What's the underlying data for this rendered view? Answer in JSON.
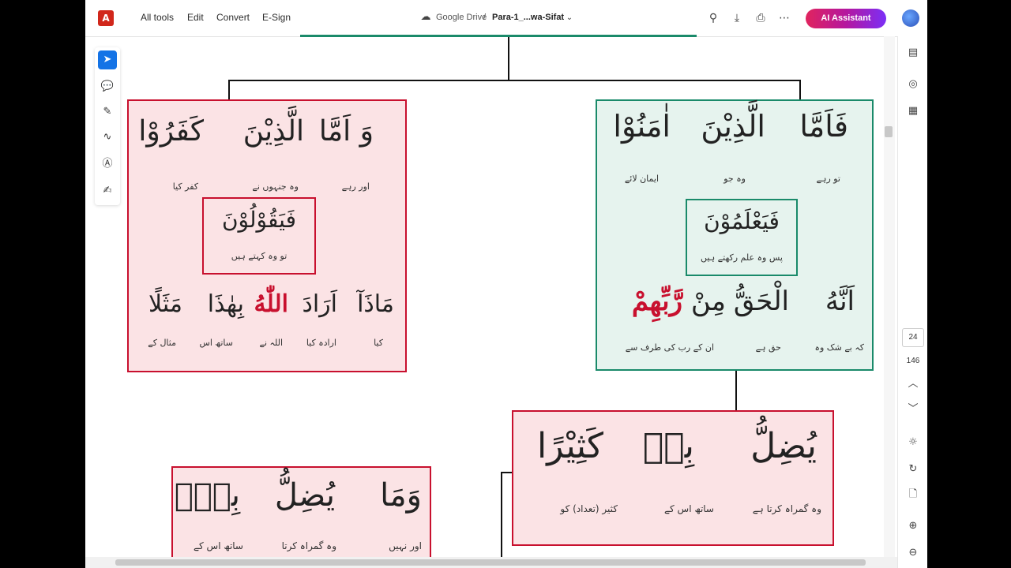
{
  "toolbar": {
    "logo_glyph": "A",
    "menu": [
      "All tools",
      "Edit",
      "Convert",
      "E-Sign"
    ],
    "drive_label": "Google Drive",
    "separator": "/",
    "file_name": "Para-1_...wa-Sifat",
    "ai_button": "AI Assistant"
  },
  "sidebar": {
    "page_current": "24",
    "page_total": "146"
  },
  "diagram": {
    "top_right": {
      "words": [
        "فَاَمَّا",
        "الَّذِيْنَ",
        "اٰمَنُوْا"
      ],
      "meanings": [
        "تو رہے",
        "وہ جو",
        "ایمان لائے"
      ],
      "inner_word": "فَيَعْلَمُوْنَ",
      "inner_meaning": "پس وہ علم رکھتے ہیں",
      "bottom_words": [
        "اَنَّهُ",
        "الْحَقُّ",
        "مِنْ",
        "رَّبِّهِمْ"
      ],
      "bottom_meanings": [
        "کہ بے شک وہ",
        "حق ہے",
        "ان کے رب کی طرف سے"
      ]
    },
    "top_left": {
      "words": [
        "وَ اَمَّا",
        "الَّذِيْنَ",
        "كَفَرُوْا"
      ],
      "meanings": [
        "اور رہے",
        "وہ جنہوں نے",
        "کفر کیا"
      ],
      "inner_word": "فَيَقُوْلُوْنَ",
      "inner_meaning": "تو وہ کہتے ہیں",
      "bottom_words": [
        "مَاذَآ",
        "اَرَادَ",
        "اللّٰهُ",
        "بِهٰذَا",
        "مَثَلًا"
      ],
      "bottom_meanings": [
        "کیا",
        "ارادہ کیا",
        "اللہ نے",
        "ساتھ اس",
        "مثال کے"
      ]
    },
    "mid_right": {
      "words": [
        "يُضِلُّ",
        "بِهٖ",
        "كَثِيْرًا"
      ],
      "meanings": [
        "وہ گمراہ کرتا ہے",
        "ساتھ اس کے",
        "کثیر (تعداد) کو"
      ]
    },
    "bottom_left": {
      "words": [
        "وَمَا",
        "يُضِلُّ",
        "بِهٖٓ"
      ],
      "meanings": [
        "اور نہیں",
        "وہ گمراہ کرتا",
        "ساتھ اس کے"
      ]
    }
  }
}
